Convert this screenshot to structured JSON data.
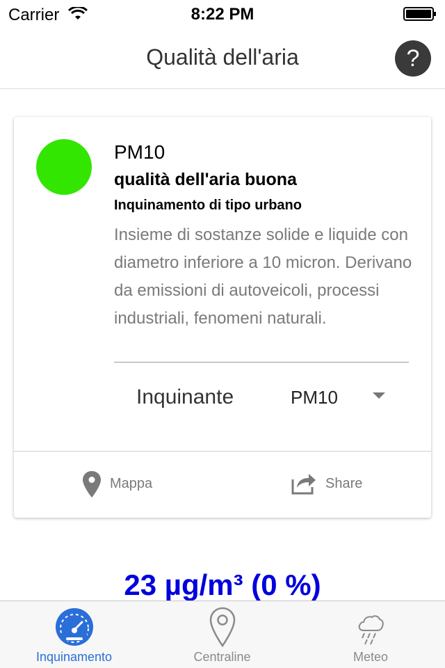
{
  "status_bar": {
    "carrier": "Carrier",
    "time": "8:22 PM"
  },
  "nav": {
    "title": "Qualità dell'aria",
    "help_label": "?"
  },
  "card": {
    "status_color": "#33e602",
    "pollutant_name": "PM10",
    "quality": "qualità dell'aria buona",
    "pollution_type": "Inquinamento di tipo urbano",
    "description": "Insieme di sostanze solide e liquide con diametro inferiore a 10 micron. Derivano da emissioni di autoveicoli, processi industriali, fenomeni naturali.",
    "selector_label": "Inquinante",
    "selector_value": "PM10",
    "actions": {
      "map_label": "Mappa",
      "share_label": "Share"
    }
  },
  "reading": {
    "value_text": "23 µg/m³ (0 %)",
    "color": "#0000dd"
  },
  "tabs": [
    {
      "label": "Inquinamento",
      "icon": "gauge-icon",
      "active": true
    },
    {
      "label": "Centraline",
      "icon": "location-pin-icon",
      "active": false
    },
    {
      "label": "Meteo",
      "icon": "rain-cloud-icon",
      "active": false
    }
  ],
  "colors": {
    "accent": "#2a6ed8",
    "good_quality": "#33e602"
  }
}
